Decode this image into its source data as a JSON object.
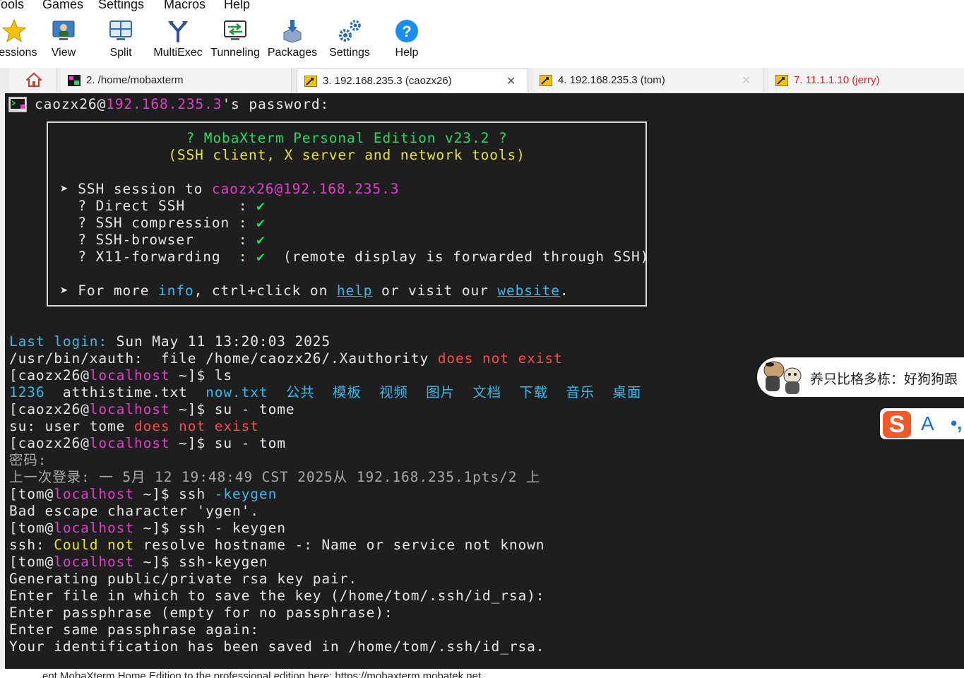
{
  "menu": [
    "Tools",
    "Games",
    "Settings",
    "Macros",
    "Help"
  ],
  "toolbar": [
    {
      "label": "Sessions",
      "icon": "star-icon"
    },
    {
      "label": "View",
      "icon": "monitor-user-icon"
    },
    {
      "label": "Split",
      "icon": "split-screen-icon"
    },
    {
      "label": "MultiExec",
      "icon": "fork-arrow-icon"
    },
    {
      "label": "Tunneling",
      "icon": "tunnel-icon"
    },
    {
      "label": "Packages",
      "icon": "package-icon"
    },
    {
      "label": "Settings",
      "icon": "gears-icon"
    },
    {
      "label": "Help",
      "icon": "question-icon"
    }
  ],
  "tabs": [
    {
      "label": "2. /home/mobaxterm",
      "state": "inactive",
      "color": "#222222"
    },
    {
      "label": "3. 192.168.235.3 (caozx26)",
      "state": "active",
      "color": "#222222"
    },
    {
      "label": "4. 192.168.235.3 (tom)",
      "state": "inactive",
      "color": "#222222"
    },
    {
      "label": "7. 11.1.1.10 (jerry)",
      "state": "inactive",
      "color": "#e02020"
    }
  ],
  "terminal": {
    "prompt_line": [
      "caozx26@",
      "192.168.235.3",
      "'s password:"
    ],
    "banner": {
      "title": "? MobaXterm Personal Edition v23.2 ?",
      "subtitle": "(SSH client, X server and network tools)",
      "session": [
        "➤ SSH session to ",
        "caozx26@192.168.235.3"
      ],
      "options": [
        {
          "name": "? Direct SSH      : ",
          "mark": "✔",
          "note": ""
        },
        {
          "name": "? SSH compression : ",
          "mark": "✔",
          "note": ""
        },
        {
          "name": "? SSH-browser     : ",
          "mark": "✔",
          "note": ""
        },
        {
          "name": "? X11-forwarding  : ",
          "mark": "✔",
          "note": "  (remote display is forwarded through SSH)"
        }
      ],
      "more": [
        "➤ For more ",
        "info",
        ", ctrl+click on ",
        "help",
        " or visit our ",
        "website",
        "."
      ]
    },
    "lines": [
      [
        {
          "t": "Last login:",
          "c": "cya"
        },
        {
          "t": " Sun May 11 13:20:03 2025",
          "c": "wht"
        }
      ],
      [
        {
          "t": "/usr/bin/xauth:  file /home/caozx26/.Xauthority ",
          "c": "wht"
        },
        {
          "t": "does not exist",
          "c": "red"
        }
      ],
      [
        {
          "t": "[caozx26@",
          "c": "wht"
        },
        {
          "t": "localhost",
          "c": "mag"
        },
        {
          "t": " ~]$ ls",
          "c": "wht"
        }
      ],
      [
        {
          "t": "1236",
          "c": "cya"
        },
        {
          "t": "  atthistime.txt  ",
          "c": "wht"
        },
        {
          "t": "now.txt  公共  模板  视频  图片  文档  下载  音乐  桌面",
          "c": "cya"
        }
      ],
      [
        {
          "t": "[caozx26@",
          "c": "wht"
        },
        {
          "t": "localhost",
          "c": "mag"
        },
        {
          "t": " ~]$ su - tome",
          "c": "wht"
        }
      ],
      [
        {
          "t": "su: user tome ",
          "c": "wht"
        },
        {
          "t": "does not exist",
          "c": "red"
        }
      ],
      [
        {
          "t": "[caozx26@",
          "c": "wht"
        },
        {
          "t": "localhost",
          "c": "mag"
        },
        {
          "t": " ~]$ su - tom",
          "c": "wht"
        }
      ],
      [
        {
          "t": "密码:",
          "c": "gry"
        }
      ],
      [
        {
          "t": "上一次登录: 一 5月 12 19:48:49 CST 2025从 192.168.235.1pts/2 上",
          "c": "gry"
        }
      ],
      [
        {
          "t": "[tom@",
          "c": "wht"
        },
        {
          "t": "localhost",
          "c": "mag"
        },
        {
          "t": " ~]$ ssh ",
          "c": "wht"
        },
        {
          "t": "-keygen",
          "c": "cya"
        }
      ],
      [
        {
          "t": "Bad escape character 'ygen'.",
          "c": "wht"
        }
      ],
      [
        {
          "t": "[tom@",
          "c": "wht"
        },
        {
          "t": "localhost",
          "c": "mag"
        },
        {
          "t": " ~]$ ssh - keygen",
          "c": "wht"
        }
      ],
      [
        {
          "t": "ssh: ",
          "c": "wht"
        },
        {
          "t": "Could not",
          "c": "yel"
        },
        {
          "t": " resolve hostname -: Name or service not known",
          "c": "wht"
        }
      ],
      [
        {
          "t": "[tom@",
          "c": "wht"
        },
        {
          "t": "localhost",
          "c": "mag"
        },
        {
          "t": " ~]$ ssh-keygen",
          "c": "wht"
        }
      ],
      [
        {
          "t": "Generating public/private rsa key pair.",
          "c": "wht"
        }
      ],
      [
        {
          "t": "Enter file in which to save the key (/home/tom/.ssh/id_rsa):",
          "c": "wht"
        }
      ],
      [
        {
          "t": "Enter passphrase (empty for no passphrase):",
          "c": "wht"
        }
      ],
      [
        {
          "t": "Enter same passphrase again:",
          "c": "wht"
        }
      ],
      [
        {
          "t": "Your identification has been saved in /home/tom/.ssh/id_rsa.",
          "c": "wht"
        }
      ]
    ]
  },
  "bottom_text": "ent MobaXterm Home Edition to the professional edition here: https://mobaxterm.mobatek.net",
  "news_bubble": "养只比格多栋：好狗狗跟",
  "ime": {
    "logo": "S",
    "mode": "A",
    "punct": "•,"
  },
  "colors": {
    "terminal_bg": "#1e1e1e",
    "magenta": "#e040c8",
    "cyan": "#3fb6e8",
    "green": "#25d86a",
    "red": "#f05050",
    "yellow": "#e8e23a"
  }
}
